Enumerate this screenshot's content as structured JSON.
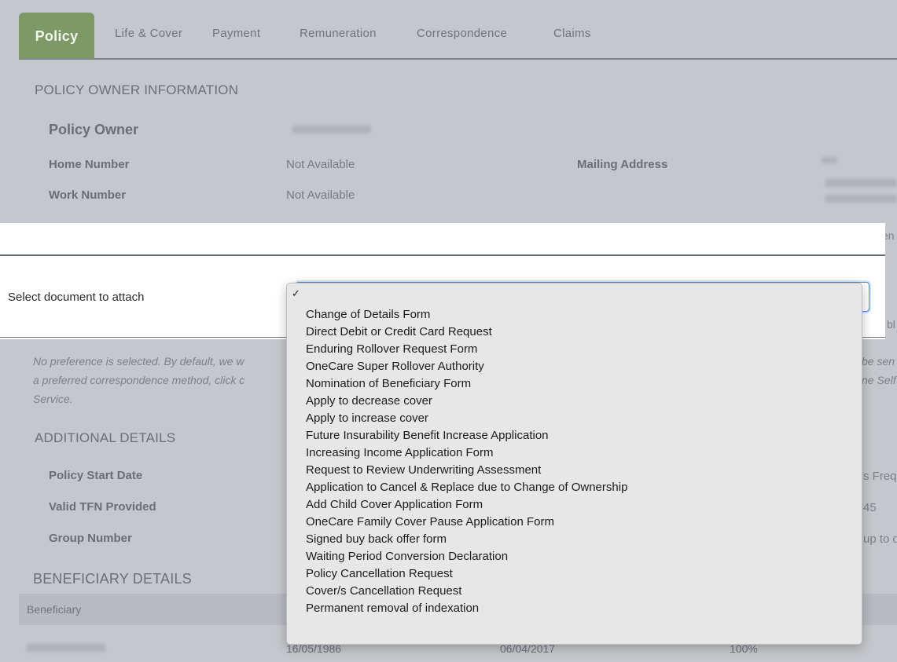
{
  "tabs": [
    {
      "label": "Policy",
      "active": true
    },
    {
      "label": "Life & Cover"
    },
    {
      "label": "Payment"
    },
    {
      "label": "Remuneration"
    },
    {
      "label": "Correspondence"
    },
    {
      "label": "Claims"
    }
  ],
  "owner_section": {
    "title": "POLICY OWNER INFORMATION",
    "policy_owner_label": "Policy Owner",
    "home_number_label": "Home Number",
    "home_number_value": "Not Available",
    "work_number_label": "Work Number",
    "work_number_value": "Not Available",
    "mailing_address_label": "Mailing Address"
  },
  "correspondence_note": {
    "line1": "No preference is selected. By default, we w",
    "line2": "a preferred correspondence method, click c",
    "line3": "Service.",
    "right1": "be sen",
    "right2": "ne Self"
  },
  "additional": {
    "title": "ADDITIONAL DETAILS",
    "start_date_label": "Policy Start Date",
    "tfn_label": "Valid TFN Provided",
    "group_label": "Group Number",
    "right_start": "s Freq",
    "right_tfn": "45",
    "right_group": "up to d"
  },
  "beneficiary": {
    "title": "BENEFICIARY DETAILS",
    "column": "Beneficiary",
    "row": {
      "dob": "16/05/1986",
      "date": "06/04/2017",
      "percent": "100%"
    }
  },
  "edge_texts": {
    "top_right_1": "en",
    "top_right_2": "bl"
  },
  "modal": {
    "label": "Select document to attach",
    "selected_mark": "✓"
  },
  "dropdown_options": [
    "Change of Details Form",
    "Direct Debit or Credit Card Request",
    "Enduring Rollover Request Form",
    "OneCare Super Rollover Authority",
    "Nomination of Beneficiary Form",
    "Apply to decrease cover",
    "Apply to increase cover",
    "Future Insurability Benefit Increase Application",
    "Increasing Income Application Form",
    "Request to Review Underwriting Assessment",
    "Application to Cancel & Replace due to Change of Ownership",
    "Add Child Cover Application Form",
    "OneCare Family Cover Pause Application Form",
    "Signed buy back offer form",
    "Waiting Period Conversion Declaration",
    "Policy Cancellation Request",
    "Cover/s Cancellation Request",
    "Permanent removal of indexation"
  ],
  "colors": {
    "tab_active": "#7e9968",
    "select_focus": "#4a90e2",
    "overlay": "#c4c7cb"
  }
}
